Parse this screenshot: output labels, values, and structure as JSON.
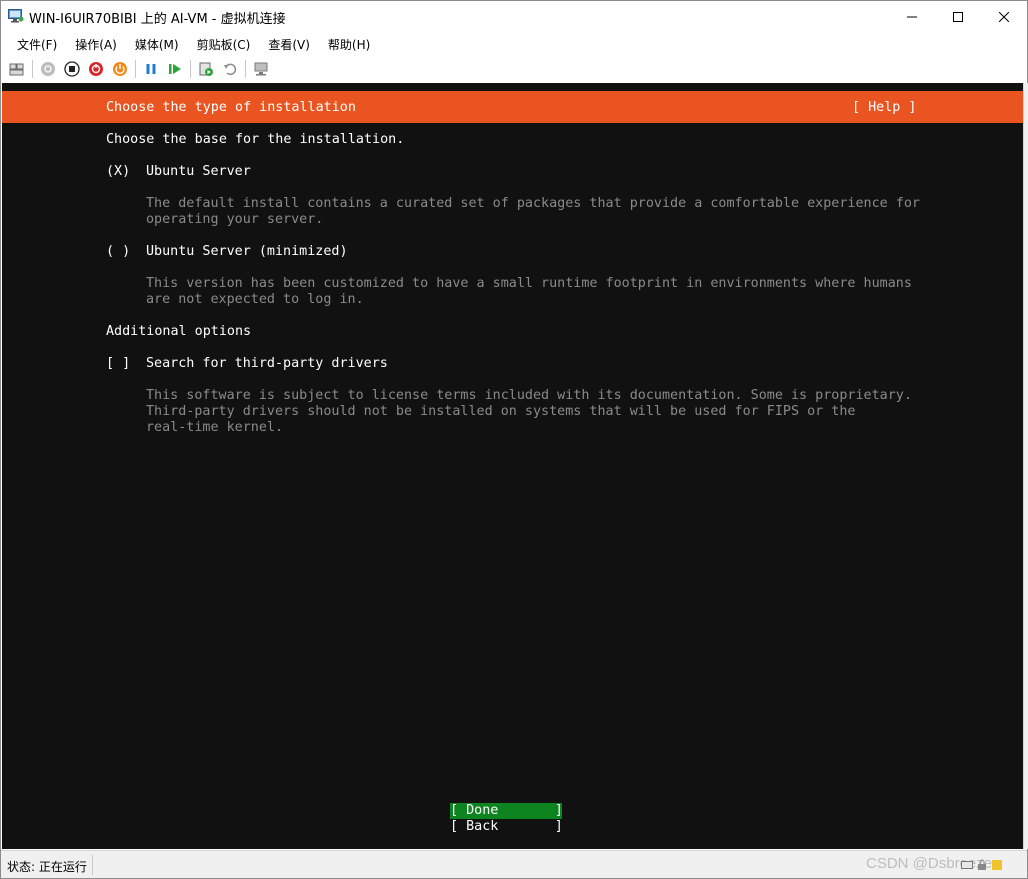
{
  "window": {
    "title": "WIN-I6UIR70BIBI 上的 AI-VM - 虚拟机连接"
  },
  "menu": {
    "items": [
      "文件(F)",
      "操作(A)",
      "媒体(M)",
      "剪贴板(C)",
      "查看(V)",
      "帮助(H)"
    ]
  },
  "toolbar": {
    "icons": [
      "ctrl-alt-del-icon",
      "start-icon",
      "turn-off-icon",
      "shutdown-icon",
      "power-icon",
      "pause-icon",
      "resume-icon",
      "checkpoint-icon",
      "revert-icon",
      "enhanced-session-icon"
    ]
  },
  "installer": {
    "header_title": "Choose the type of installation",
    "help_label": "[ Help ]",
    "intro": "Choose the base for the installation.",
    "options": [
      {
        "marker": "(X)",
        "label": "Ubuntu Server",
        "desc_lines": [
          "The default install contains a curated set of packages that provide a comfortable experience for",
          "operating your server."
        ]
      },
      {
        "marker": "( )",
        "label": "Ubuntu Server (minimized)",
        "desc_lines": [
          "This version has been customized to have a small runtime footprint in environments where humans",
          "are not expected to log in."
        ]
      }
    ],
    "additional_heading": "Additional options",
    "checkbox": {
      "marker": "[ ]",
      "label": "Search for third-party drivers",
      "desc_lines": [
        "This software is subject to license terms included with its documentation. Some is proprietary.",
        "Third-party drivers should not be installed on systems that will be used for FIPS or the",
        "real-time kernel."
      ]
    },
    "done_label": "[ Done       ]",
    "back_label": "[ Back       ]"
  },
  "status": {
    "text": "状态: 正在运行",
    "watermark": "CSDN @Dsbreeze"
  },
  "colors": {
    "ubuntu_orange": "#e95420",
    "done_green": "#0e8420",
    "console_bg": "#111111"
  }
}
